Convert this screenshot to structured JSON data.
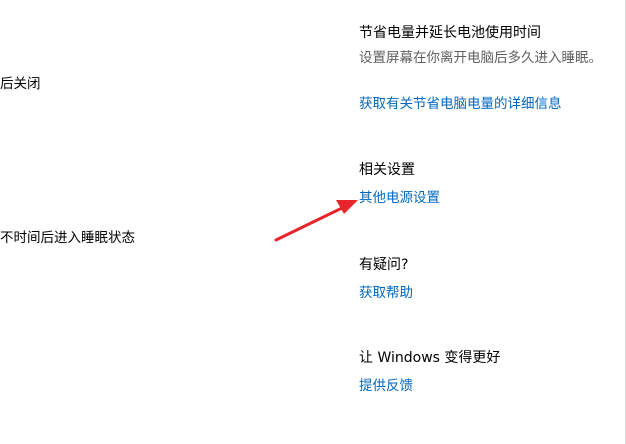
{
  "left_panel": {
    "line1": "后关闭",
    "line2": "不时间后进入睡眠状态"
  },
  "right_panel": {
    "battery_section": {
      "heading": "节省电量并延长电池使用时间",
      "description": "设置屏幕在你离开电脑后多久进入睡眠。",
      "link": "获取有关节省电脑电量的详细信息"
    },
    "related_settings": {
      "heading": "相关设置",
      "link": "其他电源设置"
    },
    "help_section": {
      "heading": "有疑问?",
      "link": "获取帮助"
    },
    "feedback_section": {
      "heading": "让 Windows 变得更好",
      "link": "提供反馈"
    }
  },
  "annotation": {
    "arrow_color": "#e8252b"
  },
  "colors": {
    "link": "#0067c0",
    "text": "#000000",
    "secondary_text": "#5f5f5f"
  }
}
